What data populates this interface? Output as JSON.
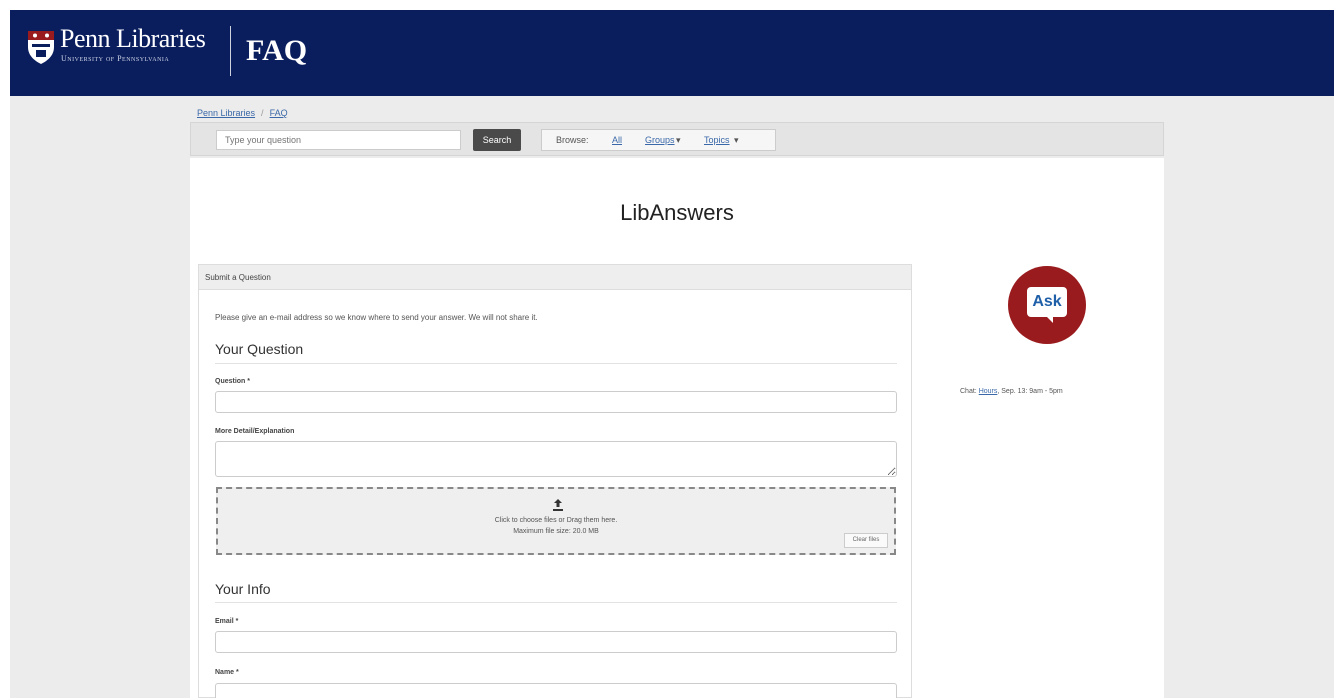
{
  "header": {
    "brand": "Penn Libraries",
    "brand_subtitle": "University of Pennsylvania",
    "site_title": "FAQ"
  },
  "breadcrumb": {
    "items": [
      "Penn Libraries",
      "FAQ"
    ]
  },
  "search": {
    "placeholder": "Type your question",
    "button_label": "Search"
  },
  "browse": {
    "label": "Browse:",
    "links": [
      "All",
      "Groups",
      "Topics"
    ]
  },
  "page_title": "LibAnswers",
  "form": {
    "panel_title": "Submit a Question",
    "intro": "Please give an e-mail address so we know where to send your answer. We will not share it.",
    "question_section": "Your Question",
    "question_label": "Question *",
    "detail_label": "More Detail/Explanation",
    "upload_line1": "Click to choose files or Drag them here.",
    "upload_line2": "Maximum file size: 20.0 MB",
    "clear_files": "Clear files",
    "info_section": "Your Info",
    "email_label": "Email *",
    "name_label": "Name *"
  },
  "sidebar": {
    "ask_label": "Ask",
    "chat_prefix": "Chat:",
    "chat_hours_link": "Hours",
    "chat_hours_suffix": ", Sep. 13: 9am - 5pm"
  },
  "colors": {
    "header_bg": "#0a1e5e",
    "ask_badge": "#9a1b1e",
    "link": "#3a68a8"
  }
}
